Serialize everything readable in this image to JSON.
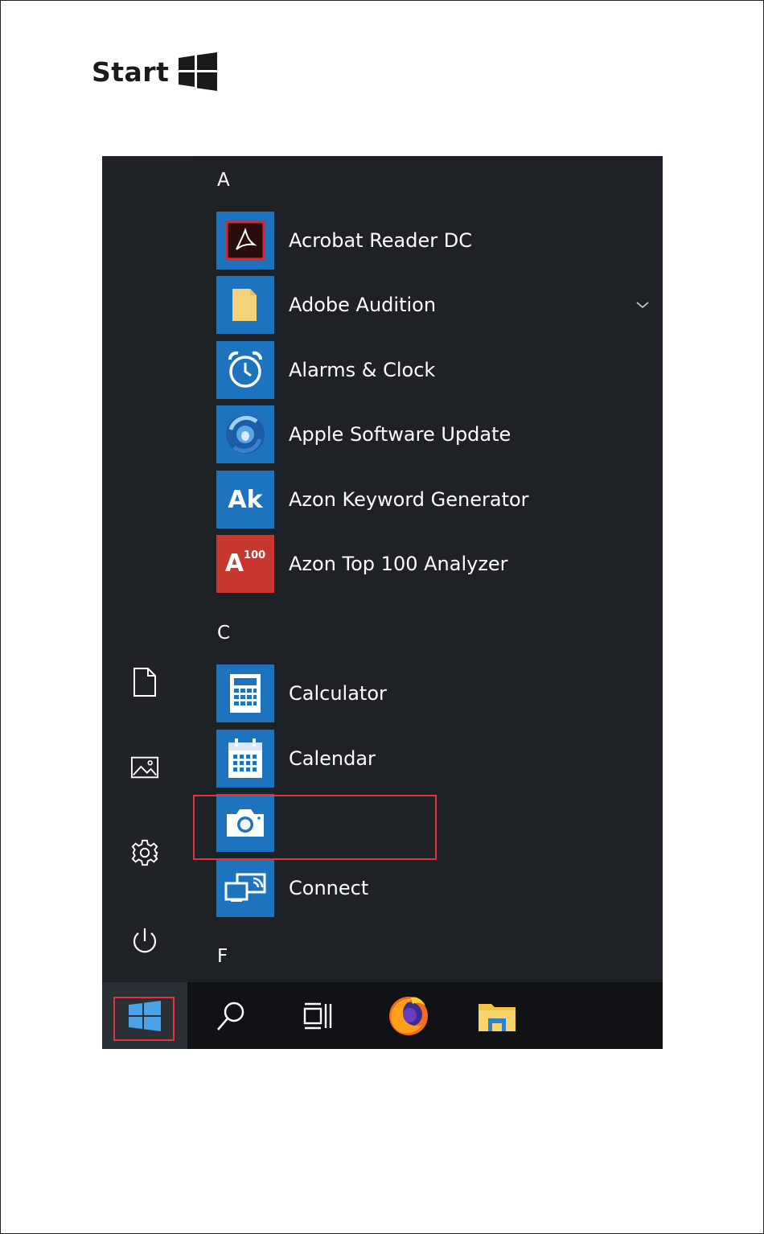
{
  "heading": {
    "title": "Start"
  },
  "start_menu": {
    "sections": [
      {
        "letter": "A",
        "apps": [
          {
            "name": "Acrobat Reader DC",
            "icon": "acrobat-icon",
            "tile_color": "#1e73bf"
          },
          {
            "name": "Adobe Audition",
            "icon": "folder-icon",
            "tile_color": "#1e73bf",
            "expandable": true
          },
          {
            "name": "Alarms & Clock",
            "icon": "alarm-clock-icon",
            "tile_color": "#1e73bf"
          },
          {
            "name": "Apple Software Update",
            "icon": "apple-update-icon",
            "tile_color": "#1e73bf"
          },
          {
            "name": "Azon Keyword Generator",
            "icon": "ak-icon",
            "tile_color": "#1e73bf",
            "icon_text": "Ak"
          },
          {
            "name": "Azon Top 100 Analyzer",
            "icon": "a100-icon",
            "tile_color": "#c8372d",
            "icon_text": "A",
            "icon_superscript": "100"
          }
        ]
      },
      {
        "letter": "C",
        "apps": [
          {
            "name": "Calculator",
            "icon": "calculator-icon",
            "tile_color": "#1e73bf"
          },
          {
            "name": "Calendar",
            "icon": "calendar-icon",
            "tile_color": "#1e73bf"
          },
          {
            "name": "",
            "icon": "camera-icon",
            "tile_color": "#1e73bf",
            "highlighted": true
          },
          {
            "name": "Connect",
            "icon": "connect-icon",
            "tile_color": "#1e73bf"
          }
        ]
      },
      {
        "letter": "F",
        "apps": []
      }
    ],
    "left_rail": [
      "document-icon",
      "pictures-icon",
      "settings-icon",
      "power-icon"
    ]
  },
  "taskbar": {
    "items": [
      "windows-start-icon",
      "search-icon",
      "task-view-icon",
      "firefox-icon",
      "file-explorer-icon"
    ],
    "start_highlighted": true
  },
  "colors": {
    "menu_background": "#1e2226",
    "tile_blue": "#1e73bf",
    "tile_red": "#c8372d",
    "highlight_red": "#e0363b",
    "taskbar": "#101215"
  }
}
